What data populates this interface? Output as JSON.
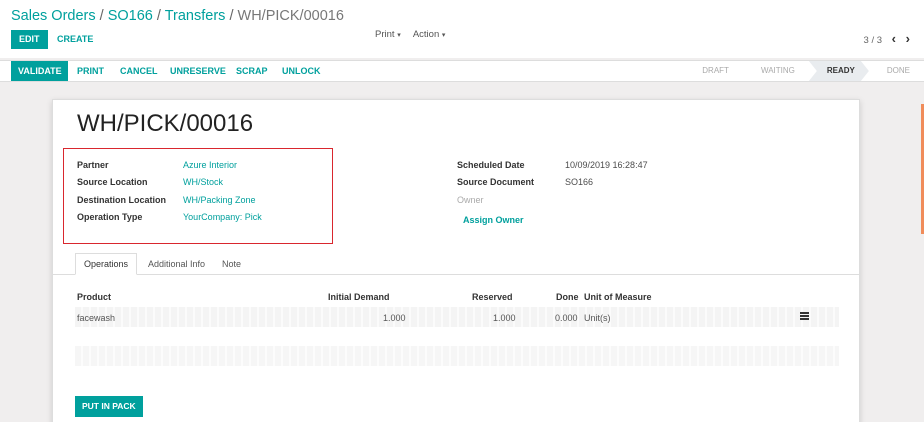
{
  "breadcrumb": {
    "items": [
      "Sales Orders",
      "SO166",
      "Transfers"
    ],
    "separator": "/",
    "current": "WH/PICK/00016"
  },
  "control": {
    "edit_label": "EDIT",
    "create_label": "CREATE",
    "print_label": "Print",
    "action_label": "Action",
    "pager": "3 / 3"
  },
  "statusbar": {
    "buttons": [
      "VALIDATE",
      "PRINT",
      "CANCEL",
      "UNRESERVE",
      "SCRAP",
      "UNLOCK"
    ],
    "stages": [
      "DRAFT",
      "WAITING",
      "READY",
      "DONE"
    ],
    "current_stage": "READY"
  },
  "form": {
    "title": "WH/PICK/00016",
    "left_fields": [
      {
        "label": "Partner",
        "value": "Azure Interior"
      },
      {
        "label": "Source Location",
        "value": "WH/Stock"
      },
      {
        "label": "Destination Location",
        "value": "WH/Packing Zone"
      },
      {
        "label": "Operation Type",
        "value": "YourCompany: Pick"
      }
    ],
    "right_fields": [
      {
        "label": "Scheduled Date",
        "value": "10/09/2019 16:28:47"
      },
      {
        "label": "Source Document",
        "value": "SO166"
      },
      {
        "label": "Owner",
        "value": ""
      }
    ],
    "assign_owner_label": "Assign Owner"
  },
  "tabs": [
    "Operations",
    "Additional Info",
    "Note"
  ],
  "table": {
    "headers": [
      "Product",
      "Initial Demand",
      "Reserved",
      "Done",
      "Unit of Measure"
    ],
    "rows": [
      {
        "product": "facewash",
        "initial_demand": "1.000",
        "reserved": "1.000",
        "done": "0.000",
        "uom": "Unit(s)"
      }
    ]
  },
  "put_in_pack_label": "PUT IN PACK",
  "colors": {
    "accent": "#00a09d",
    "highlight_border": "#d9272e"
  }
}
